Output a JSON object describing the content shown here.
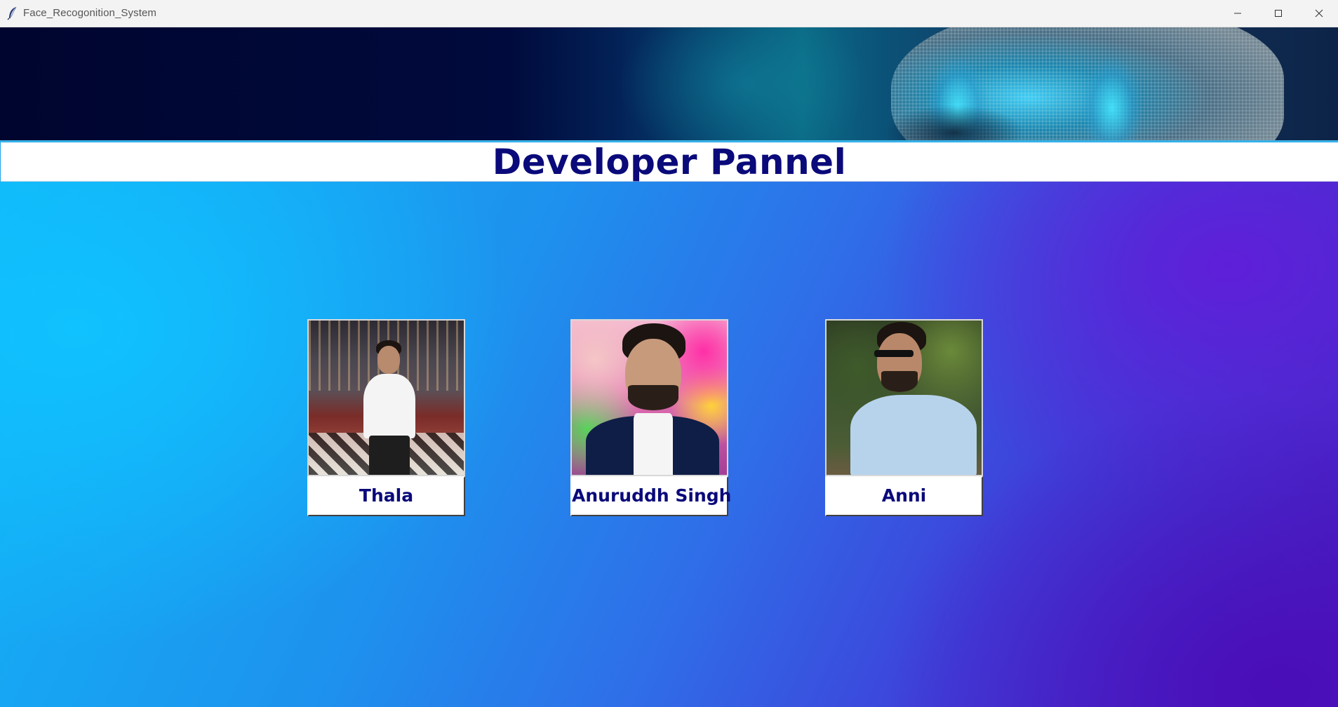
{
  "window": {
    "title": "Face_Recogonition_System"
  },
  "header": {
    "title": "Developer Pannel"
  },
  "developers": [
    {
      "name": "Thala"
    },
    {
      "name": "Anuruddh Singh"
    },
    {
      "name": "Anni"
    }
  ],
  "colors": {
    "title_text": "#0a0a7a",
    "header_bg": "#ffffff",
    "name_text": "#0a0a7a"
  },
  "icons": {
    "app": "feather-icon",
    "minimize": "minimize-icon",
    "maximize": "maximize-icon",
    "close": "close-icon"
  }
}
